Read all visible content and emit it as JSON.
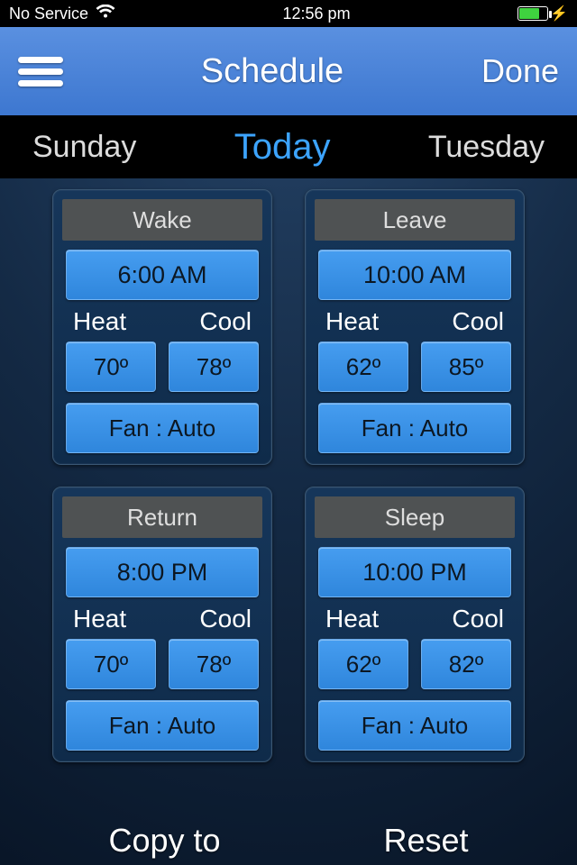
{
  "status": {
    "carrier": "No Service",
    "time": "12:56 pm"
  },
  "nav": {
    "title": "Schedule",
    "done": "Done"
  },
  "days": {
    "prev": "Sunday",
    "current": "Today",
    "next": "Tuesday"
  },
  "labels": {
    "heat": "Heat",
    "cool": "Cool"
  },
  "cards": [
    {
      "title": "Wake",
      "time": "6:00 AM",
      "heat": "70º",
      "cool": "78º",
      "fan": "Fan : Auto"
    },
    {
      "title": "Leave",
      "time": "10:00 AM",
      "heat": "62º",
      "cool": "85º",
      "fan": "Fan : Auto"
    },
    {
      "title": "Return",
      "time": "8:00 PM",
      "heat": "70º",
      "cool": "78º",
      "fan": "Fan : Auto"
    },
    {
      "title": "Sleep",
      "time": "10:00 PM",
      "heat": "62º",
      "cool": "82º",
      "fan": "Fan : Auto"
    }
  ],
  "actions": {
    "copy": "Copy to",
    "reset": "Reset"
  }
}
